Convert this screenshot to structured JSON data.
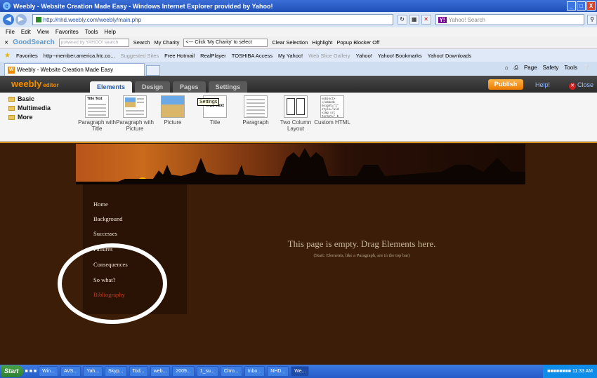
{
  "window": {
    "title": "Weebly - Website Creation Made Easy - Windows Internet Explorer provided by Yahoo!",
    "buttons": [
      "_",
      "□",
      "X"
    ]
  },
  "address_bar": {
    "url": "http://nhd.weebly.com/weebly/main.php",
    "search_placeholder": "Yahoo! Search"
  },
  "menu": [
    "File",
    "Edit",
    "View",
    "Favorites",
    "Tools",
    "Help"
  ],
  "google_toolbar": {
    "logo": "GoodSearch",
    "input_placeholder": "powered by YAHOO! search",
    "search": "Search",
    "my_charity": "My Charity",
    "charity_select": "<--- Click 'My Charity' to select",
    "clear_selection": "Clear Selection",
    "highlight": "Highlight",
    "popup_blocker": "Popup Blocker Off"
  },
  "favorites_bar": {
    "label": "Favorites",
    "items": [
      "http--member.america.htc.co...",
      "Suggested Sites",
      "Free Hotmail",
      "RealPlayer",
      "TOSHIBA Access",
      "My Yahoo!",
      "Web Slice Gallery",
      "Yahoo!",
      "Yahoo! Bookmarks",
      "Yahoo! Downloads"
    ]
  },
  "browser_tab": {
    "label": "Weebly - Website Creation Made Easy"
  },
  "command_bar": [
    "Page",
    "Safety",
    "Tools"
  ],
  "editor": {
    "logo": "weebly",
    "logo_sub": "editor",
    "tabs": [
      "Elements",
      "Design",
      "Pages",
      "Settings"
    ],
    "active_tab": "Elements",
    "publish": "Publish",
    "help": "Help!",
    "close": "Close",
    "categories": [
      "Basic",
      "Multimedia",
      "More"
    ],
    "elements": [
      {
        "label": "Paragraph with Title"
      },
      {
        "label": "Paragraph with Picture"
      },
      {
        "label": "Picture"
      },
      {
        "label": "Title"
      },
      {
        "label": "Paragraph"
      },
      {
        "label": "Two Column Layout"
      },
      {
        "label": "Custom HTML"
      }
    ],
    "tooltip": "Settings",
    "title_thumb_text": "Title Text"
  },
  "site": {
    "nav": [
      "Home",
      "Background",
      "Successes",
      "Failures",
      "Consequences",
      "So what?",
      "Bibliography"
    ],
    "active_nav": "Bibliography",
    "empty_title": "This page is empty. Drag Elements here.",
    "empty_sub": "(Start: Elements, like a Paragraph, are in the top bar)"
  },
  "taskbar": {
    "start": "Start",
    "items": [
      "Win...",
      "AVS...",
      "Yah...",
      "Skyp...",
      "Tod...",
      "web...",
      "2009...",
      "1_su...",
      "Chro...",
      "Inbo...",
      "NHD...",
      "We..."
    ],
    "active_item": "We...",
    "time": "11:33 AM"
  },
  "colors": {
    "publish": "#ea7a00",
    "page_bg": "#3b1d08",
    "annotation_circle": "#ffffff"
  }
}
